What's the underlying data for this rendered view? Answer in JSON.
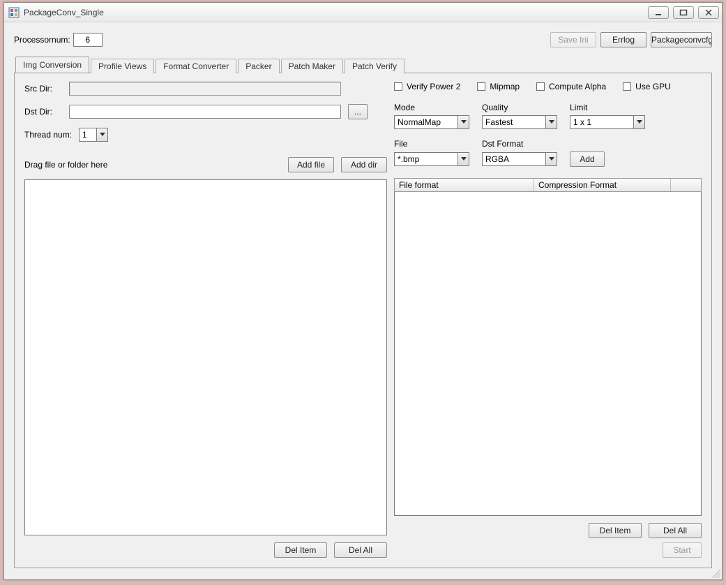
{
  "window": {
    "title": "PackageConv_Single"
  },
  "toolbar": {
    "processornum_label": "Processornum:",
    "processornum_value": "6",
    "save_ini": "Save Ini",
    "errlog": "Errlog",
    "packageconvcfg": "Packageconvcfg"
  },
  "tabs": [
    "Img Conversion",
    "Profile Views",
    "Format Converter",
    "Packer",
    "Patch Maker",
    "Patch Verify"
  ],
  "left": {
    "src_dir_label": "Src Dir:",
    "src_dir_value": "",
    "dst_dir_label": "Dst Dir:",
    "dst_dir_value": "",
    "browse": "...",
    "thread_num_label": "Thread num:",
    "thread_num_value": "1",
    "drag_hint": "Drag file or folder here",
    "add_file": "Add file",
    "add_dir": "Add dir",
    "del_item": "Del Item",
    "del_all": "Del All"
  },
  "right": {
    "checks": {
      "verify_power2": "Verify Power 2",
      "mipmap": "Mipmap",
      "compute_alpha": "Compute Alpha",
      "use_gpu": "Use GPU"
    },
    "mode_label": "Mode",
    "mode_value": "NormalMap",
    "quality_label": "Quality",
    "quality_value": "Fastest",
    "limit_label": "Limit",
    "limit_value": "1 x 1",
    "file_label": "File",
    "file_value": "*.bmp",
    "dstformat_label": "Dst Format",
    "dstformat_value": "RGBA",
    "add": "Add",
    "col_file_format": "File format",
    "col_compression": "Compression Format",
    "del_item": "Del Item",
    "del_all": "Del All",
    "start": "Start"
  }
}
